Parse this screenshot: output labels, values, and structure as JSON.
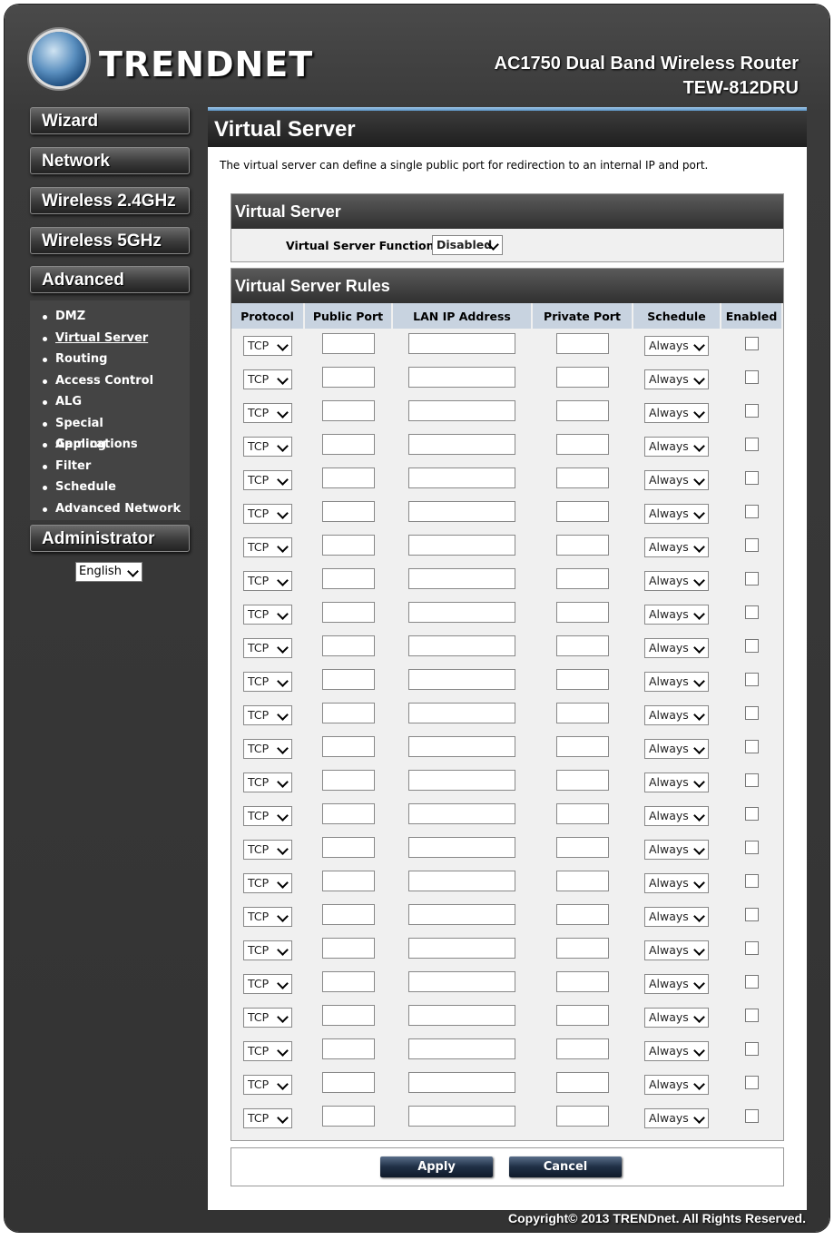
{
  "header": {
    "brand": "TRENDNET",
    "product_line1": "AC1750 Dual Band Wireless Router",
    "product_line2": "TEW-812DRU"
  },
  "sidebar": {
    "menu": [
      {
        "label": "Wizard"
      },
      {
        "label": "Network"
      },
      {
        "label": "Wireless 2.4GHz"
      },
      {
        "label": "Wireless 5GHz"
      },
      {
        "label": "Advanced"
      }
    ],
    "advanced_items": [
      {
        "label": "DMZ"
      },
      {
        "label": "Virtual Server"
      },
      {
        "label": "Routing"
      },
      {
        "label": "Access Control"
      },
      {
        "label": "ALG"
      },
      {
        "label": "Special Applications"
      },
      {
        "label": "Gaming"
      },
      {
        "label": "Filter"
      },
      {
        "label": "Schedule"
      },
      {
        "label": "Advanced Network"
      }
    ],
    "admin_label": "Administrator",
    "language": "English"
  },
  "main": {
    "title": "Virtual Server",
    "description": "The virtual server can define a single public port for redirection to an internal IP and port.",
    "function_panel": {
      "heading": "Virtual Server",
      "label": "Virtual Server Function",
      "value": "Disabled"
    },
    "rules_panel": {
      "heading": "Virtual Server Rules",
      "columns": [
        "Protocol",
        "Public Port",
        "LAN IP Address",
        "Private Port",
        "Schedule",
        "Enabled"
      ],
      "row_count": 24,
      "protocol_default": "TCP",
      "schedule_default": "Always"
    },
    "apply_label": "Apply",
    "cancel_label": "Cancel"
  },
  "footer": {
    "copyright": "Copyright© 2013 TRENDnet. All Rights Reserved."
  }
}
